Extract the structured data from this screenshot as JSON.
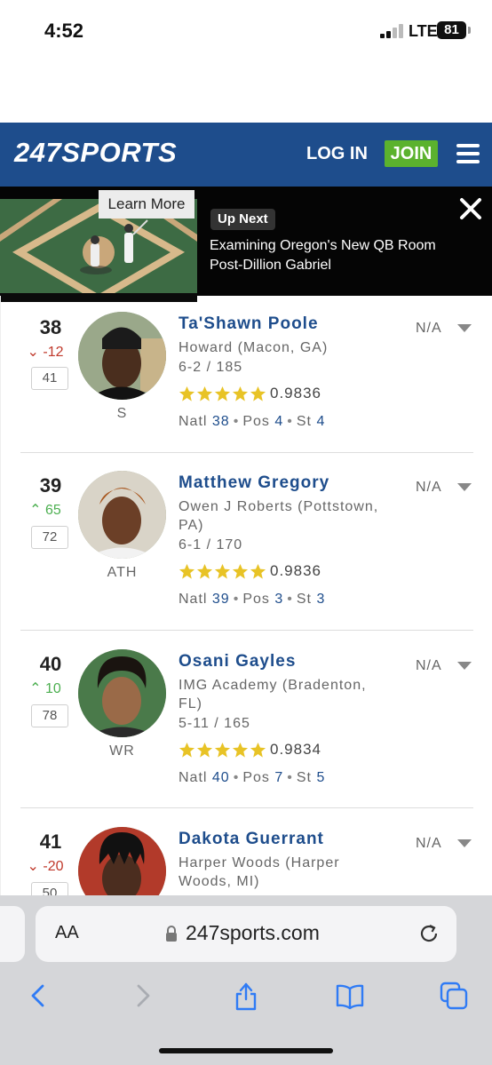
{
  "status_bar": {
    "time": "4:52",
    "network": "LTE",
    "battery": "81"
  },
  "header": {
    "logo": "247SPORTS",
    "login": "LOG IN",
    "join": "JOIN"
  },
  "promo": {
    "learn_more": "Learn More",
    "up_next": "Up Next",
    "title": "Examining Oregon's New QB Room Post-Dillion Gabriel"
  },
  "players": [
    {
      "rank": "38",
      "change": "-12",
      "prev_rank": "41",
      "position": "S",
      "name": "Ta'Shawn Poole",
      "school": "Howard (Macon, GA)",
      "size": "6-2 / 185",
      "rating": "0.9836",
      "natl": "38",
      "pos_rank": "4",
      "st_rank": "4",
      "status": "N/A"
    },
    {
      "rank": "39",
      "change": "65",
      "prev_rank": "72",
      "position": "ATH",
      "name": "Matthew Gregory",
      "school": "Owen J Roberts (Pottstown, PA)",
      "size": "6-1 / 170",
      "rating": "0.9836",
      "natl": "39",
      "pos_rank": "3",
      "st_rank": "3",
      "status": "N/A"
    },
    {
      "rank": "40",
      "change": "10",
      "prev_rank": "78",
      "position": "WR",
      "name": "Osani Gayles",
      "school": "IMG Academy (Bradenton, FL)",
      "size": "5-11 / 165",
      "rating": "0.9834",
      "natl": "40",
      "pos_rank": "7",
      "st_rank": "5",
      "status": "N/A"
    },
    {
      "rank": "41",
      "change": "-20",
      "prev_rank": "50",
      "position": "",
      "name": "Dakota Guerrant",
      "school": "Harper Woods (Harper Woods, MI)",
      "size": "",
      "rating": "",
      "natl": "",
      "pos_rank": "",
      "st_rank": "",
      "status": "N/A"
    }
  ],
  "labels": {
    "natl": "Natl",
    "pos": "Pos",
    "st": "St"
  },
  "browser": {
    "aa": "AA",
    "url": "247sports.com"
  },
  "colors": {
    "brand_blue": "#1e4d8c",
    "join_green": "#5bb22e",
    "star_gold": "#e8c326",
    "down_red": "#c0392b",
    "up_green": "#4caf50",
    "ios_blue": "#2f7bf5"
  }
}
